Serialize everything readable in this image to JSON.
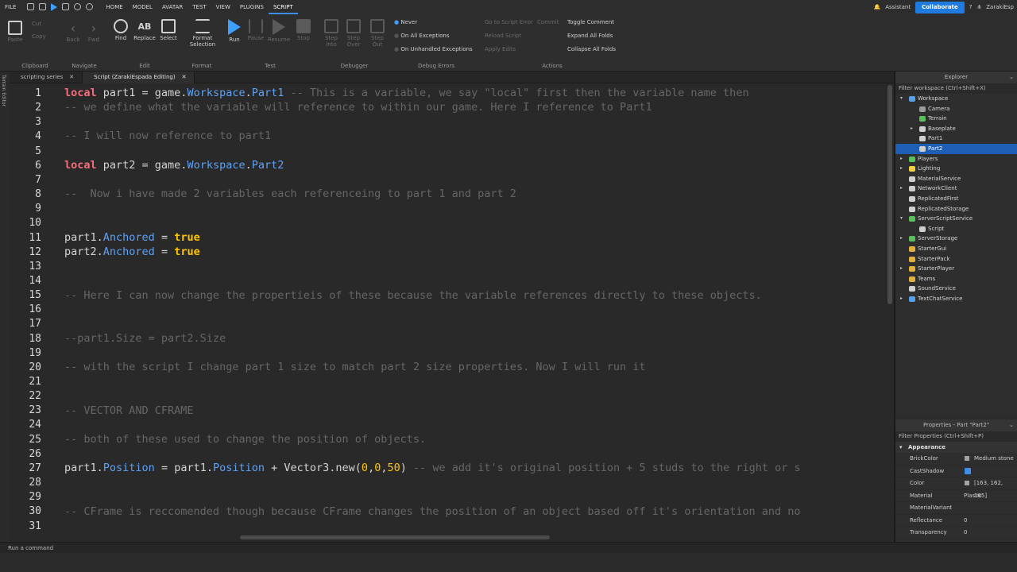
{
  "menu": {
    "items": [
      "FILE",
      "HOME",
      "MODEL",
      "AVATAR",
      "TEST",
      "VIEW",
      "PLUGINS",
      "SCRIPT"
    ],
    "active": "SCRIPT",
    "assistant": "Assistant",
    "collaborate": "Collaborate",
    "user": "ZarakiEsp"
  },
  "ribbon": {
    "clipboard": {
      "label": "Clipboard",
      "paste": "Paste",
      "cut": "Cut",
      "copy": "Copy"
    },
    "navigate": {
      "label": "Navigate",
      "back": "Back",
      "fwd": "Fwd"
    },
    "edit": {
      "label": "Edit",
      "find": "Find",
      "replace": "Replace",
      "select": "Select"
    },
    "format": {
      "label": "Format",
      "button": "Format Selection"
    },
    "test": {
      "label": "Test",
      "run": "Run",
      "pause": "Pause",
      "resume": "Resume",
      "stop": "Stop"
    },
    "debugger": {
      "label": "Debugger",
      "step_into": "Step Into",
      "step_over": "Step Over",
      "step_out": "Step Out"
    },
    "debug_errors": {
      "label": "Debug Errors",
      "never": "Never",
      "all": "On All Exceptions",
      "unhandled": "On Unhandled Exceptions"
    },
    "actions": {
      "label": "Actions",
      "goto": "Go to Script Error",
      "commit": "Commit",
      "reload": "Reload Script",
      "apply": "Apply Edits",
      "toggle": "Toggle Comment",
      "expand": "Expand All Folds",
      "collapse": "Collapse All Folds"
    }
  },
  "side_strip": "Terrain Editor",
  "tabs": [
    {
      "label": "scripting series"
    },
    {
      "label": "Script (ZarakiEspada Editing)"
    }
  ],
  "editor": {
    "line_numbers": [
      "1",
      "2",
      "3",
      "4",
      "5",
      "6",
      "7",
      "8",
      "9",
      "10",
      "11",
      "12",
      "13",
      "14",
      "15",
      "16",
      "17",
      "18",
      "19",
      "20",
      "21",
      "22",
      "23",
      "24",
      "25",
      "26",
      "27",
      "28",
      "29",
      "30",
      "31"
    ]
  },
  "explorer": {
    "title": "Explorer",
    "filter": "Filter workspace (Ctrl+Shift+X)",
    "items": [
      "Workspace",
      "Camera",
      "Terrain",
      "Baseplate",
      "Part1",
      "Part2",
      "Players",
      "Lighting",
      "MaterialService",
      "NetworkClient",
      "ReplicatedFirst",
      "ReplicatedStorage",
      "ServerScriptService",
      "Script",
      "ServerStorage",
      "StarterGui",
      "StarterPack",
      "StarterPlayer",
      "Teams",
      "SoundService",
      "TextChatService"
    ]
  },
  "properties": {
    "title": "Properties - Part \"Part2\"",
    "filter": "Filter Properties (Ctrl+Shift+P)",
    "section": "Appearance",
    "rows": [
      {
        "name": "BrickColor",
        "value": "Medium stone"
      },
      {
        "name": "CastShadow",
        "value": ""
      },
      {
        "name": "Color",
        "value": "[163, 162, 165]"
      },
      {
        "name": "Material",
        "value": "Plastic"
      },
      {
        "name": "MaterialVariant",
        "value": ""
      },
      {
        "name": "Reflectance",
        "value": "0"
      },
      {
        "name": "Transparency",
        "value": "0"
      }
    ]
  },
  "command_bar": {
    "placeholder": "Run a command"
  },
  "code": {
    "l1": {
      "a": "local",
      "b": " part1 = game.",
      "c": "Workspace",
      "d": ".",
      "e": "Part1",
      "f": " -- This is a variable, we say \"local\" first then the variable name then"
    },
    "l2": "-- we define what the variable will reference to within our game. Here I reference to Part1",
    "l4": "-- I will now reference to part1",
    "l6": {
      "a": "local",
      "b": " part2 = game.",
      "c": "Workspace",
      "d": ".",
      "e": "Part2"
    },
    "l8": "--  Now i have made 2 variables each referenceing to part 1 and part 2",
    "l11": {
      "a": "part1.",
      "b": "Anchored",
      "c": " = ",
      "d": "true"
    },
    "l12": {
      "a": "part2.",
      "b": "Anchored",
      "c": " = ",
      "d": "true"
    },
    "l15": "-- Here I can now change the propertieis of these because the variable references directly to these objects.",
    "l18": "--part1.Size = part2.Size",
    "l20": "-- with the script I change part 1 size to match part 2 size properties. Now I will run it",
    "l23": "-- VECTOR AND CFRAME",
    "l25": "-- both of these used to change the position of objects.",
    "l27": {
      "a": "part1.",
      "b": "Position",
      "c": " = part1.",
      "d": "Position",
      "e": " + Vector3.new(",
      "f": "0",
      "g": ",",
      "h": "0",
      "i": ",",
      "j": "50",
      "k": ")",
      "l": " -- we add it's original position + 5 studs to the right or s"
    },
    "l30": "-- CFrame is reccomended though because CFrame changes the position of an object based off it's orientation and no"
  }
}
